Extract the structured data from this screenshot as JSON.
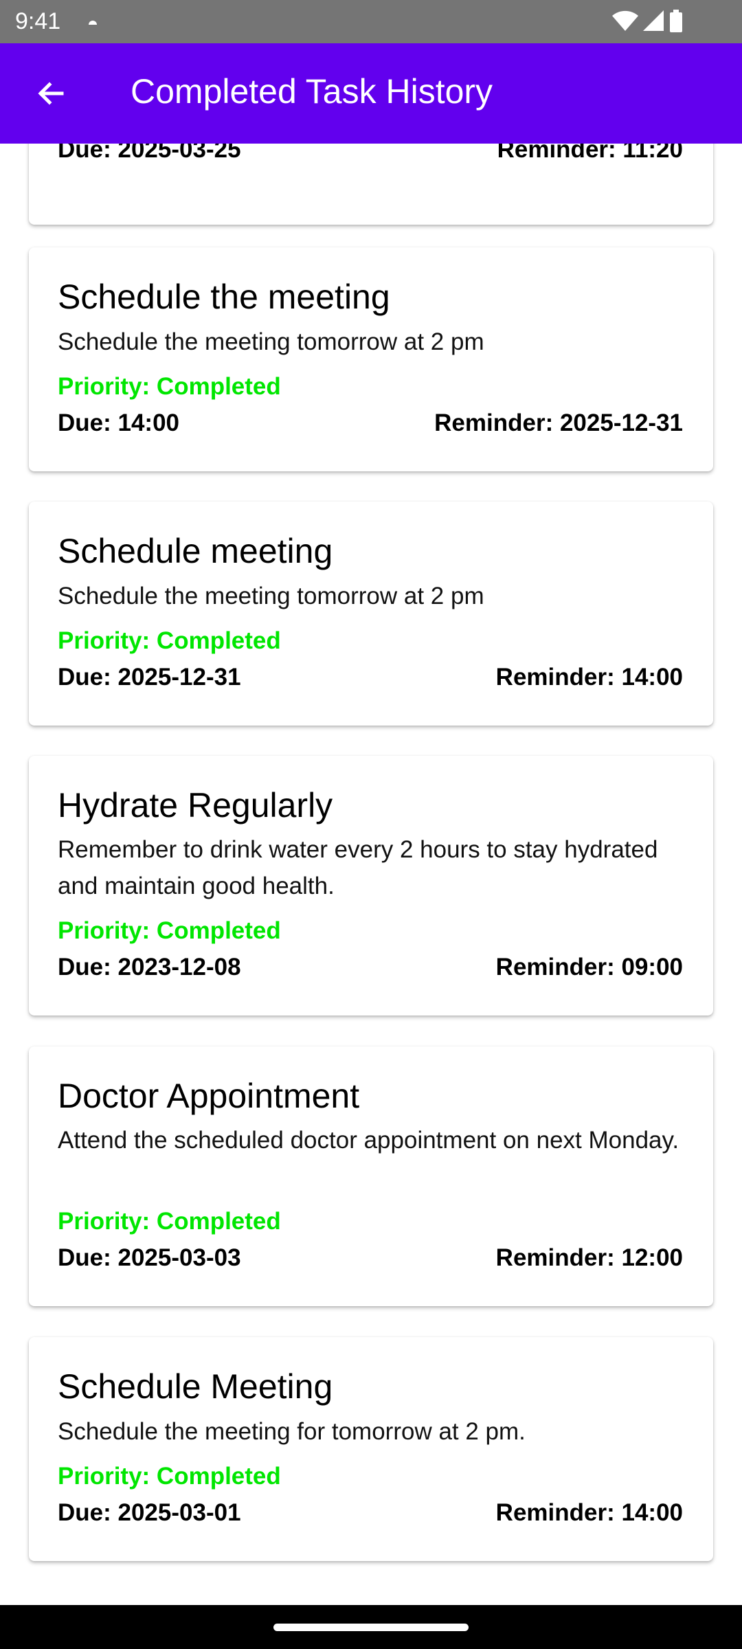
{
  "status_bar": {
    "time": "9:41",
    "icons": [
      "notification-dot-icon",
      "wifi-icon",
      "signal-icon",
      "battery-icon"
    ]
  },
  "app_bar": {
    "title": "Completed Task History",
    "back_icon": "arrow-left-icon",
    "background": "#6200EE"
  },
  "colors": {
    "priority": "#00E600",
    "app_bar": "#6200EE",
    "status_bar": "#757575"
  },
  "partial_card": {
    "due": "Due: 2025-03-25",
    "reminder": "Reminder: 11:20"
  },
  "tasks": [
    {
      "title": "Schedule the meeting",
      "description": "Schedule the meeting tomorrow at 2 pm",
      "priority": "Priority: Completed",
      "due": "Due: 14:00",
      "reminder": "Reminder: 2025-12-31"
    },
    {
      "title": "Schedule meeting",
      "description": "Schedule the meeting tomorrow at 2 pm",
      "priority": "Priority: Completed",
      "due": "Due: 2025-12-31",
      "reminder": "Reminder: 14:00"
    },
    {
      "title": "Hydrate Regularly",
      "description": "Remember to drink water every 2 hours to stay hydrated and maintain good health.",
      "priority": "Priority: Completed",
      "due": "Due: 2023-12-08",
      "reminder": "Reminder: 09:00"
    },
    {
      "title": "Doctor Appointment",
      "description": "Attend the scheduled doctor appointment on next Monday.",
      "priority": "Priority: Completed",
      "due": "Due: 2025-03-03",
      "reminder": "Reminder: 12:00"
    },
    {
      "title": "Schedule Meeting",
      "description": "Schedule the meeting for tomorrow at 2 pm.",
      "priority": "Priority: Completed",
      "due": "Due: 2025-03-01",
      "reminder": "Reminder: 14:00"
    }
  ]
}
